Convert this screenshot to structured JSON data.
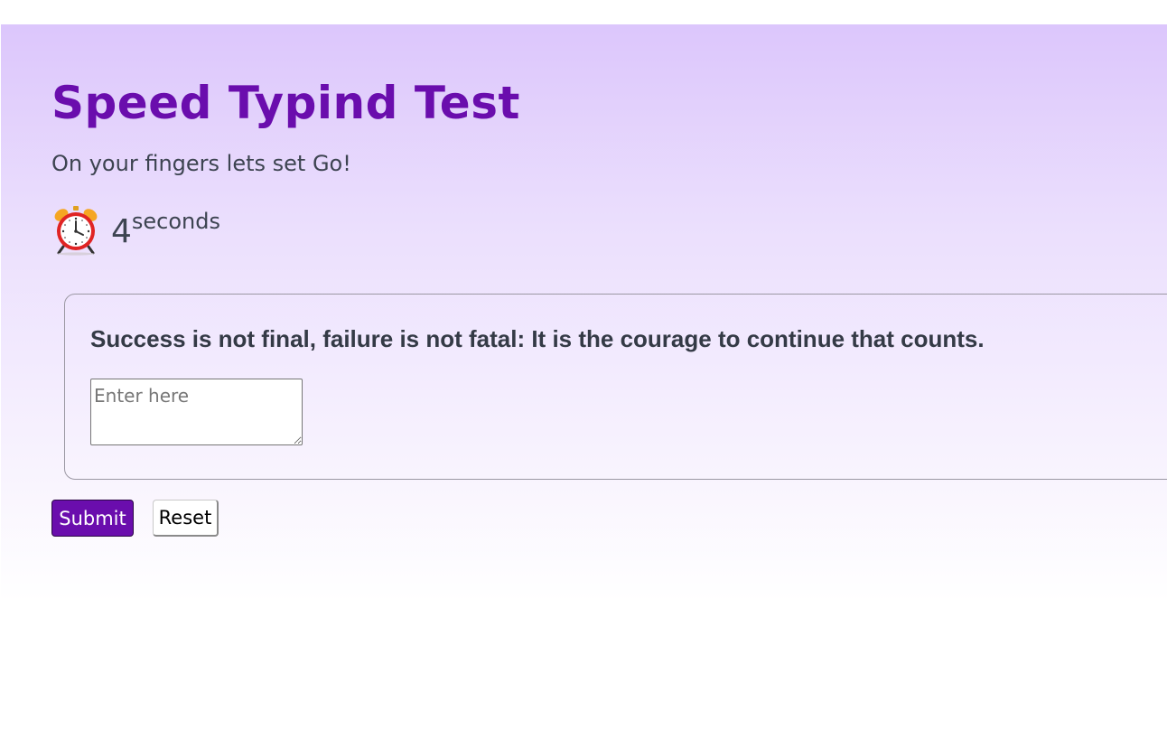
{
  "page": {
    "title": "Speed Typind Test",
    "subtitle": "On your fingers lets set Go!"
  },
  "timer": {
    "icon": "alarm-clock-icon",
    "count": "4",
    "unit": "seconds"
  },
  "quote": {
    "text": "Success is not final, failure is not fatal: It is the courage to continue that counts."
  },
  "answer": {
    "value": "",
    "placeholder": "Enter here"
  },
  "buttons": {
    "submit_label": "Submit",
    "reset_label": "Reset"
  },
  "colors": {
    "accent": "#6a0dad",
    "text": "#3d4451",
    "gradient_top": "#dcc6fc",
    "gradient_bottom": "#ffffff"
  }
}
